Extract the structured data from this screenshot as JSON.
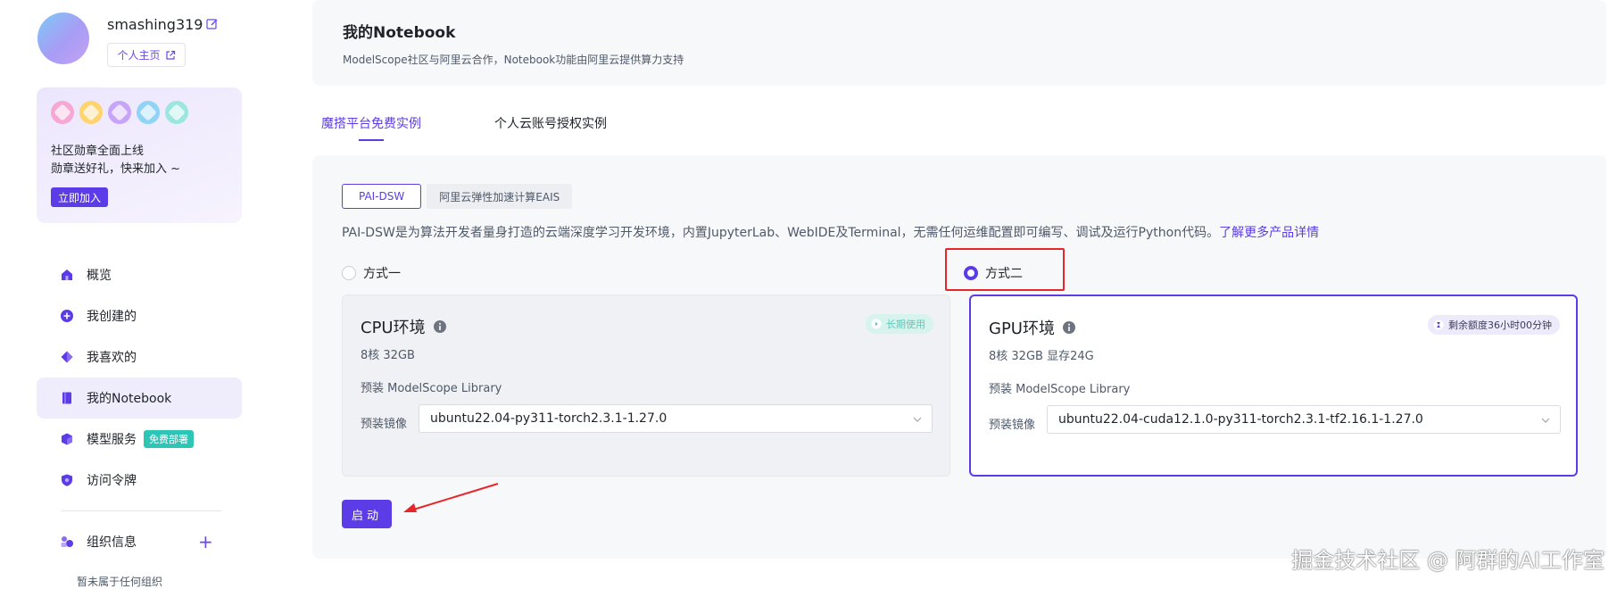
{
  "sidebar": {
    "username": "smashing319",
    "homepage_label": "个人主页",
    "badge_card": {
      "line1": "社区勋章全面上线",
      "line2": "勋章送好礼，快来加入 ~",
      "join_label": "立即加入",
      "badge_colors": [
        "#f6a7d3",
        "#ffd36e",
        "#c7a4f7",
        "#8fd3f7",
        "#9ce6e0"
      ]
    },
    "nav": [
      {
        "label": "概览",
        "icon": "home-icon"
      },
      {
        "label": "我创建的",
        "icon": "plus-circle-icon"
      },
      {
        "label": "我喜欢的",
        "icon": "heart-diamond-icon"
      },
      {
        "label": "我的Notebook",
        "icon": "notebook-icon",
        "active": true
      },
      {
        "label": "模型服务",
        "icon": "cube-icon",
        "tag": "免费部署"
      },
      {
        "label": "访问令牌",
        "icon": "shield-icon"
      }
    ],
    "org_label": "组织信息",
    "no_org": "暂未属于任何组织"
  },
  "header": {
    "title": "我的Notebook",
    "subtitle": "ModelScope社区与阿里云合作，Notebook功能由阿里云提供算力支持"
  },
  "tabs": [
    "魔搭平台免费实例",
    "个人云账号授权实例"
  ],
  "panel": {
    "subtabs": [
      "PAI-DSW",
      "阿里云弹性加速计算EAIS"
    ],
    "description": "PAI-DSW是为算法开发者量身打造的云端深度学习开发环境，内置JupyterLab、WebIDE及Terminal，无需任何运维配置即可编写、调试及运行Python代码。",
    "description_link": "了解更多产品详情",
    "options": [
      "方式一",
      "方式二"
    ],
    "selected_option": "方式二",
    "cpu": {
      "title": "CPU环境",
      "spec": "8核 32GB",
      "lib": "预装 ModelScope Library",
      "image_label": "预装镜像",
      "image_value": "ubuntu22.04-py311-torch2.3.1-1.27.0",
      "status": "长期使用"
    },
    "gpu": {
      "title": "GPU环境",
      "spec": "8核 32GB 显存24G",
      "lib": "预装 ModelScope Library",
      "image_label": "预装镜像",
      "image_value": "ubuntu22.04-cuda12.1.0-py311-torch2.3.1-tf2.16.1-1.27.0",
      "status": "剩余额度36小时00分钟"
    },
    "start_label": "启动"
  },
  "watermark": "掘金技术社区 @ 阿群的AI工作室",
  "colors": {
    "accent": "#5b3ce6",
    "highlight_box": "#e8262a",
    "free_tag": "#2ec4b6"
  }
}
